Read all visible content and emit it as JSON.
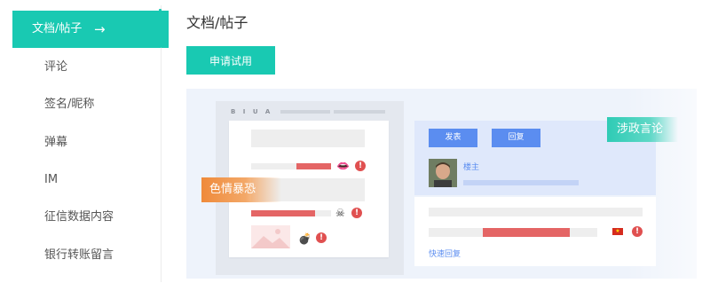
{
  "sidebar": {
    "items": [
      {
        "label": "文档/帖子",
        "active": true
      },
      {
        "label": "评论"
      },
      {
        "label": "签名/昵称"
      },
      {
        "label": "弹幕"
      },
      {
        "label": "IM"
      },
      {
        "label": "征信数据内容"
      },
      {
        "label": "银行转账留言"
      }
    ],
    "active_arrow": "→",
    "accent_color": "#19c9b2"
  },
  "main": {
    "title": "文档/帖子",
    "apply_button": "申请试用",
    "illustration": {
      "editor_toolbar": "B I U A",
      "tag_porn_violence": "色情暴恐",
      "tag_political": "涉政言论",
      "post_button": "发表",
      "reply_button": "回复",
      "owner_label": "楼主",
      "quick_reply": "快速回复",
      "warning_glyph": "!",
      "flag_glyph": "★"
    }
  },
  "colors": {
    "primary": "#19c9b2",
    "warning": "#e05050",
    "link_blue": "#5b8df0",
    "tag_orange": "#ef8a3a"
  },
  "icons": [
    "right-arrow-icon",
    "warning-icon",
    "lips-icon",
    "skull-icon",
    "bomb-icon",
    "flag-icon",
    "image-placeholder-icon"
  ]
}
